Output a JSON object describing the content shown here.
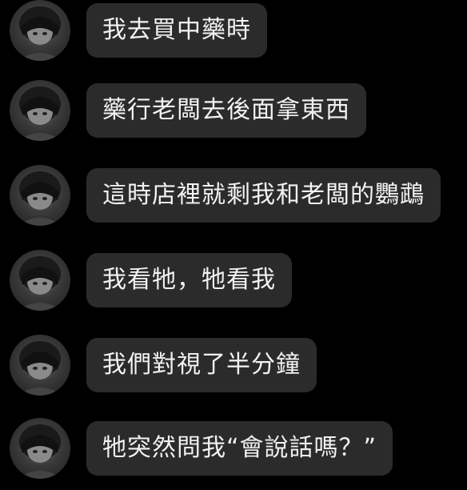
{
  "messages": [
    {
      "text": "我去買中藥時"
    },
    {
      "text": "藥行老闆去後面拿東西"
    },
    {
      "text": "這時店裡就剩我和老闆的鸚鵡"
    },
    {
      "text": "我看牠，牠看我"
    },
    {
      "text": "我們對視了半分鐘"
    },
    {
      "text": "牠突然問我“會說話嗎？”"
    }
  ],
  "colors": {
    "background": "#000000",
    "bubble": "#2b2b2b",
    "text": "#f2f2f2"
  }
}
